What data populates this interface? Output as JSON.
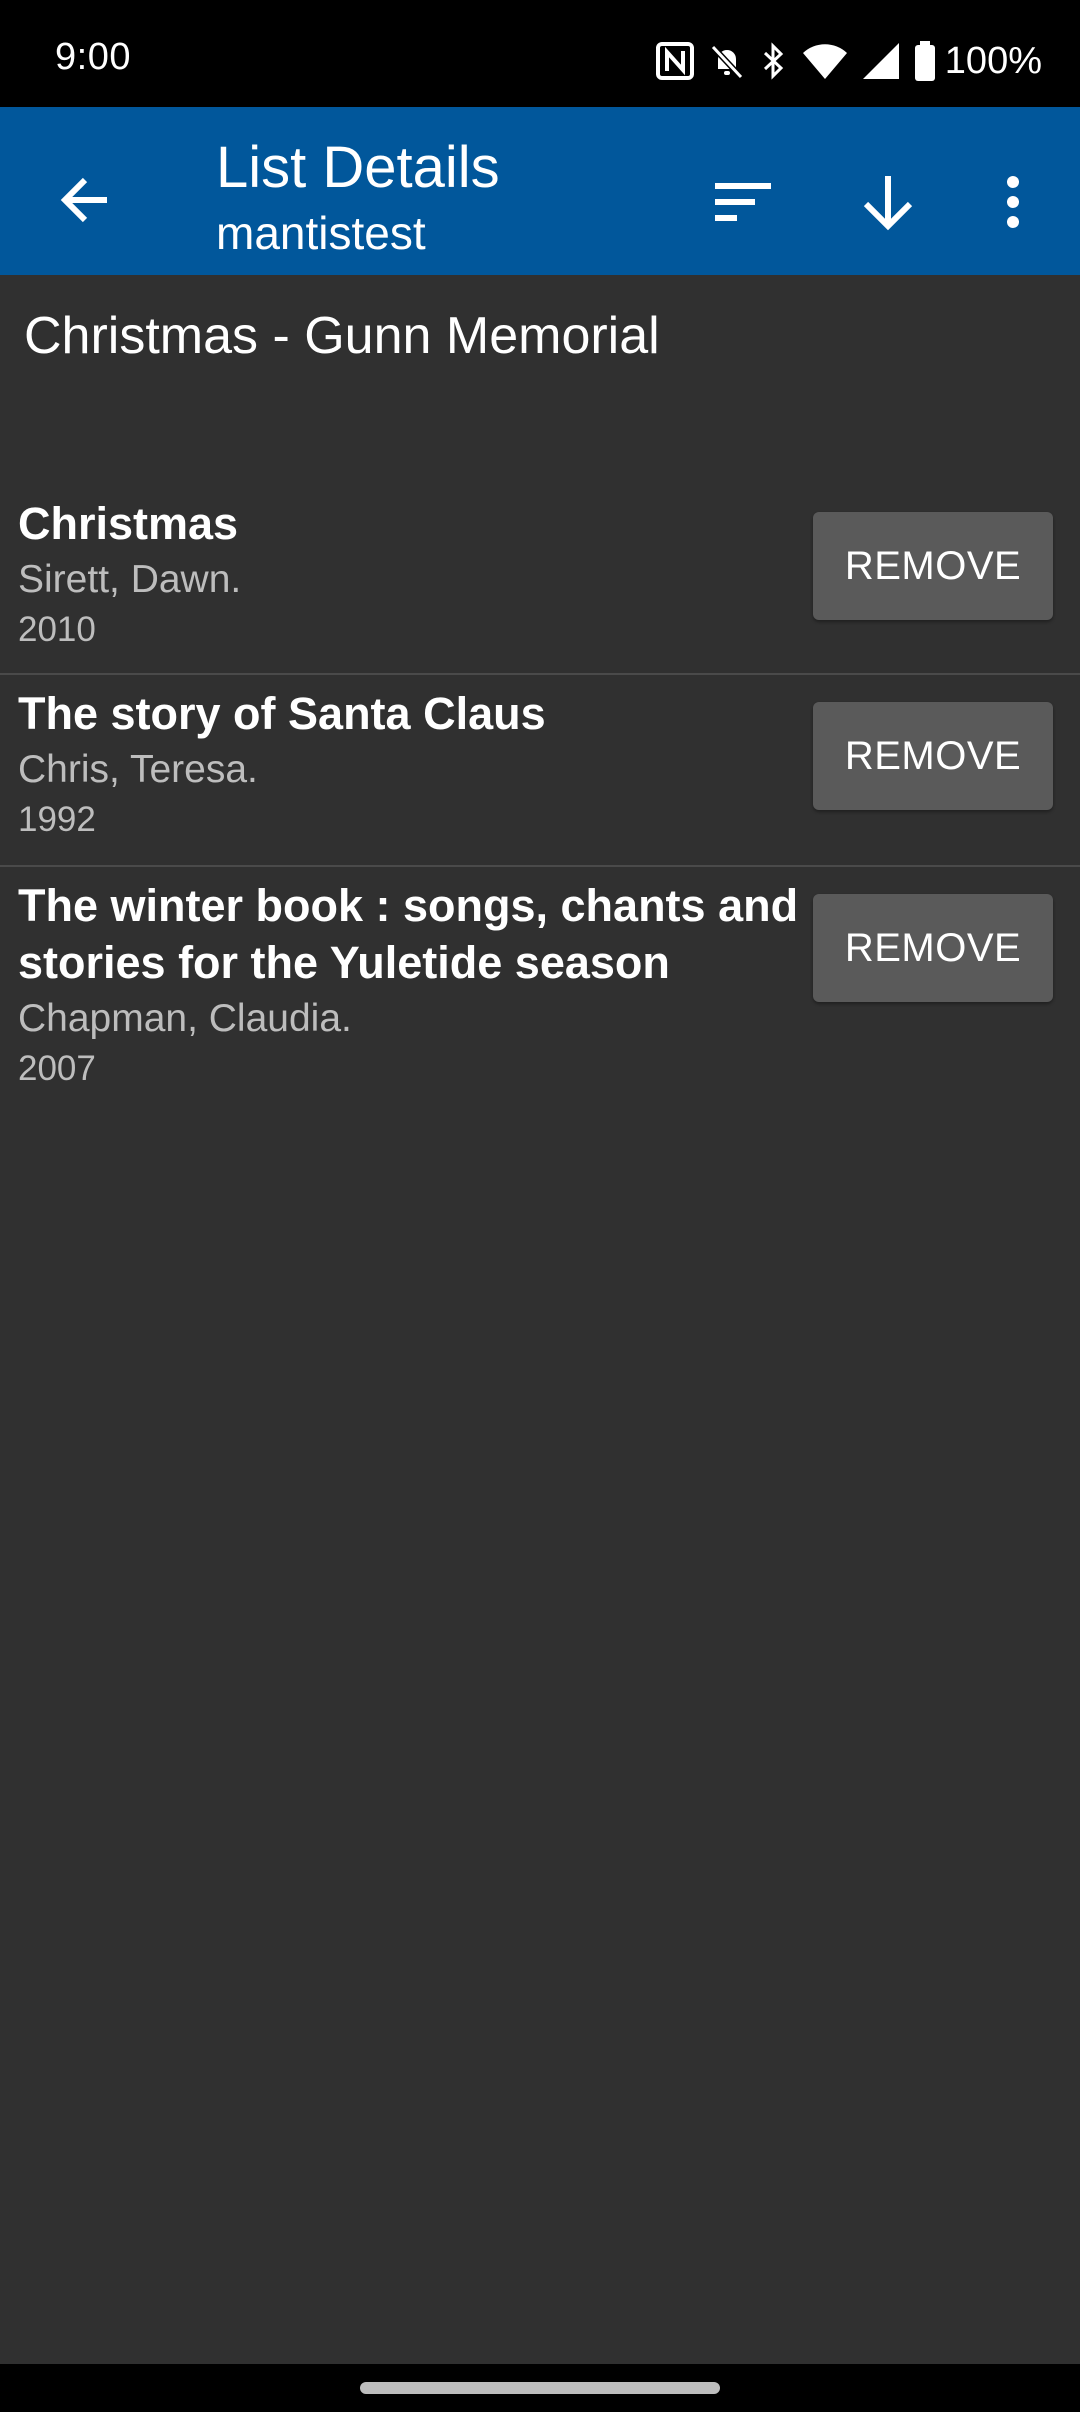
{
  "status_bar": {
    "time": "9:00",
    "battery": "100%",
    "icons": [
      "nfc-icon",
      "bell-off-icon",
      "bluetooth-icon",
      "wifi-icon",
      "signal-icon",
      "battery-icon"
    ]
  },
  "app_bar": {
    "title": "List Details",
    "subtitle": "mantistest",
    "background": "#01579b",
    "actions": [
      "back-arrow-icon",
      "sort-icon",
      "download-icon",
      "more-vert-icon"
    ]
  },
  "list": {
    "name": "Christmas - Gunn Memorial",
    "items": [
      {
        "title": "Christmas",
        "author": "Sirett, Dawn.",
        "year": "2010",
        "button": "REMOVE"
      },
      {
        "title": "The story of Santa Claus",
        "author": "Chris, Teresa.",
        "year": "1992",
        "button": "REMOVE"
      },
      {
        "title": "The winter book : songs, chants and stories for the Yuletide season",
        "author": "Chapman, Claudia.",
        "year": "2007",
        "button": "REMOVE"
      }
    ]
  }
}
